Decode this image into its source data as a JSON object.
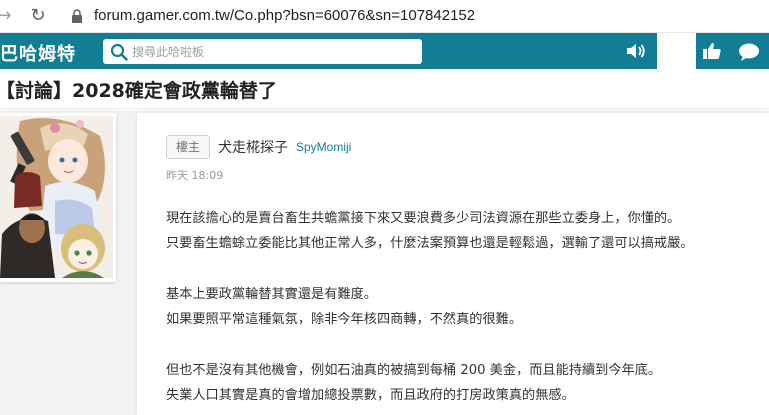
{
  "browser": {
    "url": "forum.gamer.com.tw/Co.php?bsn=60076&sn=107842152",
    "back_icon": "arrow-left-icon",
    "reload_icon": "reload-icon",
    "lock_icon": "lock-icon"
  },
  "header": {
    "logo_text": "巴哈姆特",
    "search_placeholder": "搜尋此哈啦板",
    "accent_color": "#117e96"
  },
  "thread": {
    "title": "【討論】2028確定會政黨輪替了"
  },
  "post": {
    "floor_label": "樓主",
    "author_name": "犬走椛探子",
    "author_id": "SpyMomiji",
    "timestamp": "昨天 18:09",
    "lines": [
      "現在該擔心的是賣台畜生共蟾黨接下來又要浪費多少司法資源在那些立委身上，你懂的。",
      "只要畜生蟾蜍立委能比其他正常人多，什麼法案預算也還是輕鬆過，選輸了還可以搞戒嚴。",
      "基本上要政黨輪替其實還是有難度。",
      "如果要照平常這種氣氛，除非今年核四商轉，不然真的很難。",
      "但也不是沒有其他機會，例如石油真的被搞到每桶 200 美金，而且能持續到今年底。",
      "失業人口其實是真的會增加總投票數，而且政府的打房政策真的無感。"
    ]
  }
}
